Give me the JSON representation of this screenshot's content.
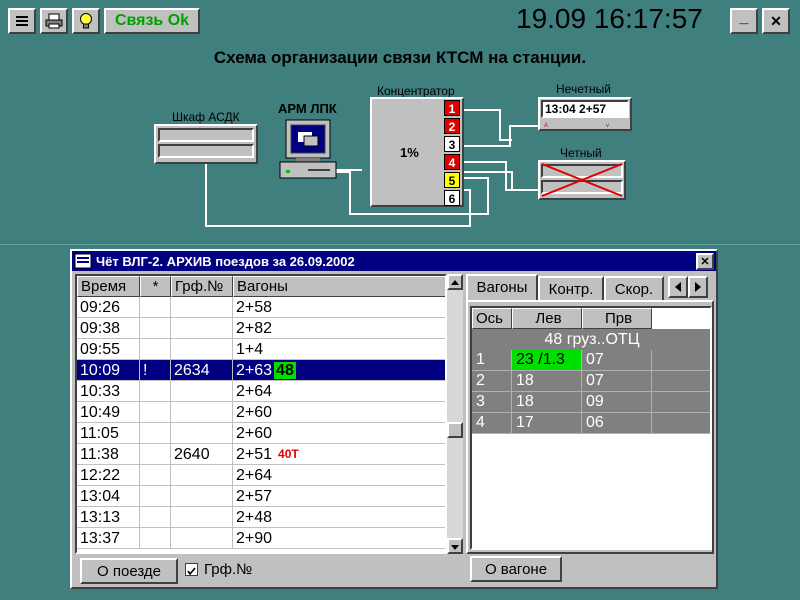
{
  "toolbar": {
    "status_label": "Связь Ok",
    "clock": "19.09 16:17:57",
    "minimize_glyph": "_",
    "close_glyph": "✕"
  },
  "diagram": {
    "title": "Схема организации связи КТСМ на станции.",
    "cabinet_label": "Шкаф АСДК",
    "arm_label": "АРМ ЛПК",
    "concentrator_label": "Концентратор",
    "concentrator_load": "1%",
    "ports": [
      {
        "num": "1",
        "color": "#e00000",
        "text_color": "#ffffff"
      },
      {
        "num": "2",
        "color": "#e00000",
        "text_color": "#ffffff"
      },
      {
        "num": "3",
        "color": "#ffffff",
        "text_color": "#000000"
      },
      {
        "num": "4",
        "color": "#e00000",
        "text_color": "#ffffff"
      },
      {
        "num": "5",
        "color": "#ffff00",
        "text_color": "#000000"
      },
      {
        "num": "6",
        "color": "#ffffff",
        "text_color": "#000000"
      }
    ],
    "odd_label": "Нечетный",
    "odd_display": "13:04 2+57",
    "even_label": "Четный"
  },
  "archive": {
    "title": "Чёт ВЛГ-2. АРХИВ поездов за 26.09.2002",
    "columns": [
      "Время",
      "*",
      "Грф.№",
      "Вагоны"
    ],
    "rows": [
      {
        "time": "09:26",
        "star": "",
        "grf": "",
        "wagons": "2+58",
        "badge": ""
      },
      {
        "time": "09:38",
        "star": "",
        "grf": "",
        "wagons": "2+82",
        "badge": ""
      },
      {
        "time": "09:55",
        "star": "",
        "grf": "",
        "wagons": "1+4",
        "badge": ""
      },
      {
        "time": "10:09",
        "star": "!",
        "grf": "2634",
        "wagons": "2+63",
        "badge": "48"
      },
      {
        "time": "10:33",
        "star": "",
        "grf": "",
        "wagons": "2+64",
        "badge": ""
      },
      {
        "time": "10:49",
        "star": "",
        "grf": "",
        "wagons": "2+60",
        "badge": ""
      },
      {
        "time": "11:05",
        "star": "",
        "grf": "",
        "wagons": "2+60",
        "badge": ""
      },
      {
        "time": "11:38",
        "star": "",
        "grf": "2640",
        "wagons": "2+51",
        "badge": "40Т"
      },
      {
        "time": "12:22",
        "star": "",
        "grf": "",
        "wagons": "2+64",
        "badge": ""
      },
      {
        "time": "13:04",
        "star": "",
        "grf": "",
        "wagons": "2+57",
        "badge": ""
      },
      {
        "time": "13:13",
        "star": "",
        "grf": "",
        "wagons": "2+48",
        "badge": ""
      },
      {
        "time": "13:37",
        "star": "",
        "grf": "",
        "wagons": "2+90",
        "badge": ""
      }
    ],
    "selected_row": 3,
    "train_button": "О поезде",
    "grf_checkbox_label": "Грф.№",
    "grf_checked": true,
    "tabs": [
      "Вагоны",
      "Контр.",
      "Скор."
    ],
    "axle_columns": [
      "Ось",
      "Лев",
      "Прв"
    ],
    "wagon_info": "48  груз..ОТЦ",
    "axles": [
      {
        "n": "1",
        "left": "23 /1.3",
        "right": "07",
        "alert": true
      },
      {
        "n": "2",
        "left": "18",
        "right": "07",
        "alert": false
      },
      {
        "n": "3",
        "left": "18",
        "right": "09",
        "alert": false
      },
      {
        "n": "4",
        "left": "17",
        "right": "06",
        "alert": false
      }
    ],
    "wagon_button": "О вагоне"
  },
  "colors": {
    "background": "#3f7f7e",
    "selection": "#000080",
    "alert_green": "#00e000",
    "alert_red": "#e00000"
  }
}
